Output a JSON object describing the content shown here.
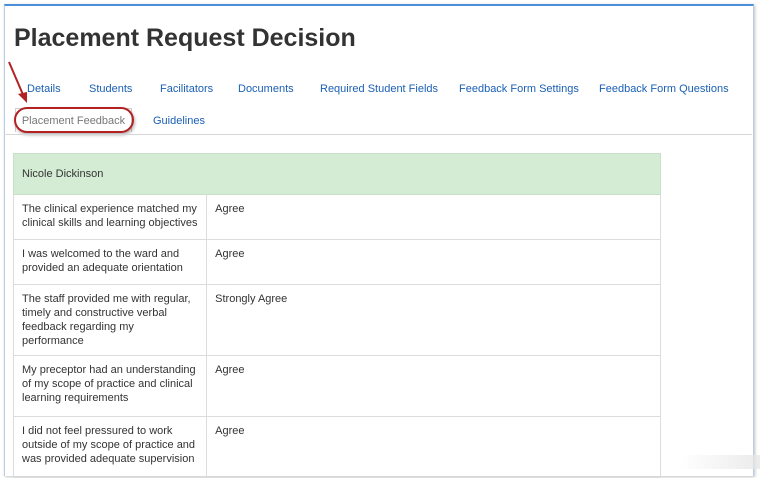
{
  "page": {
    "title": "Placement Request Decision"
  },
  "tabs": {
    "row1": [
      "Details",
      "Students",
      "Facilitators",
      "Documents",
      "Required Student Fields",
      "Feedback Form Settings",
      "Feedback Form Questions"
    ],
    "row2": [
      "Placement Feedback",
      "Guidelines"
    ],
    "active": "Placement Feedback"
  },
  "feedback": {
    "student_name": "Nicole Dickinson",
    "rows": [
      {
        "question": "The clinical experience matched my clinical skills and learning objectives",
        "answer": "Agree"
      },
      {
        "question": "I was welcomed to the ward and provided an adequate orientation",
        "answer": "Agree"
      },
      {
        "question": "The staff provided me with regular, timely and constructive verbal feedback regarding my performance",
        "answer": "Strongly Agree"
      },
      {
        "question": "My preceptor had an understanding of my scope of practice and clinical learning requirements",
        "answer": "Agree"
      },
      {
        "question": "I did not feel pressured to work outside of my scope of practice and was provided adequate supervision",
        "answer": "Agree"
      }
    ]
  },
  "colors": {
    "link": "#1a5fb4",
    "header_row_bg": "#d4ecd4",
    "highlight": "#b22222"
  }
}
